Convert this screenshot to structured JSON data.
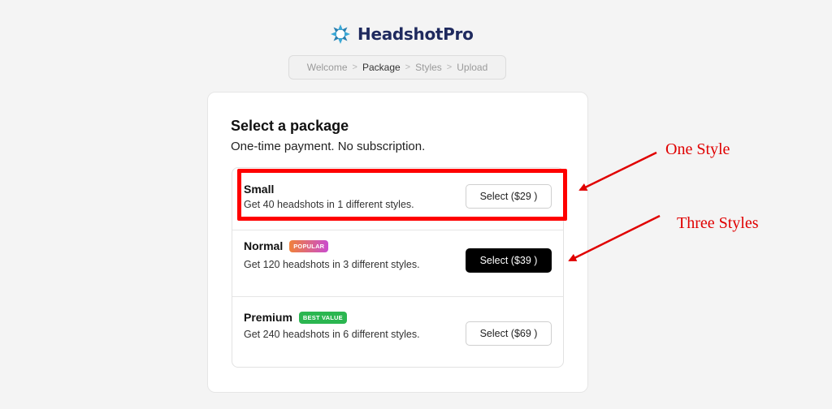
{
  "brand": {
    "name": "HeadshotPro"
  },
  "breadcrumb": [
    {
      "label": "Welcome",
      "active": false
    },
    {
      "label": "Package",
      "active": true
    },
    {
      "label": "Styles",
      "active": false
    },
    {
      "label": "Upload",
      "active": false
    }
  ],
  "card": {
    "title": "Select a package",
    "subtitle": "One-time payment. No subscription."
  },
  "packages": [
    {
      "name": "Small",
      "badge": "",
      "description": "Get 40 headshots in 1 different styles.",
      "button": "Select ($29 )",
      "highlighted": false
    },
    {
      "name": "Normal",
      "badge": "POPULAR",
      "description": "Get 120 headshots in 3 different styles.",
      "button": "Select ($39 )",
      "highlighted": true
    },
    {
      "name": "Premium",
      "badge": "BEST VALUE",
      "description": "Get 240 headshots in 6 different styles.",
      "button": "Select ($69 )",
      "highlighted": false
    }
  ],
  "annotations": {
    "one_style": "One Style",
    "three_styles": "Three Styles",
    "color": "#e00000"
  },
  "colors": {
    "brand_text": "#1f2a5e",
    "logo_blue": "#3aa8d6",
    "popular_badge_start": "#f0813a",
    "popular_badge_end": "#c94ccf",
    "best_value_badge": "#2bb650"
  }
}
